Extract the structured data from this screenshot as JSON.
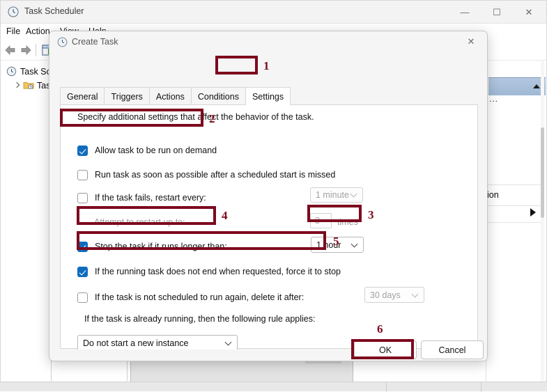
{
  "background_window": {
    "title": "Task Scheduler",
    "title_icon": "clock-icon",
    "controls": {
      "minimize": "—",
      "maximize": "☐",
      "close": "✕"
    },
    "menu": [
      "File",
      "Action",
      "View",
      "Help"
    ],
    "toolbar_icons": [
      "back-arrow-icon",
      "forward-arrow-icon",
      "grid-view-icon"
    ],
    "tree": {
      "root": "Task Sche",
      "child": "Task S"
    },
    "right_panel": {
      "ellipsis": "...",
      "partial_label": "ion"
    }
  },
  "dialog": {
    "title": "Create Task",
    "title_icon": "clock-icon",
    "close_glyph": "✕",
    "tabs": [
      {
        "label": "General",
        "active": false
      },
      {
        "label": "Triggers",
        "active": false
      },
      {
        "label": "Actions",
        "active": false
      },
      {
        "label": "Conditions",
        "active": false
      },
      {
        "label": "Settings",
        "active": true
      }
    ],
    "description": "Specify additional settings that affect the behavior of the task.",
    "options": [
      {
        "label": "Allow task to be run on demand",
        "checked": true,
        "disabled": false
      },
      {
        "label": "Run task as soon as possible after a scheduled start is missed",
        "checked": false,
        "disabled": false
      },
      {
        "label": "If the task fails, restart every:",
        "checked": false,
        "disabled": false
      },
      {
        "label": "Stop the task if it runs longer than:",
        "checked": true,
        "disabled": false
      },
      {
        "label": "If the running task does not end when requested, force it to stop",
        "checked": true,
        "disabled": false
      },
      {
        "label": "If the task is not scheduled to run again, delete it after:",
        "checked": false,
        "disabled": false
      }
    ],
    "attempt_label": "Attempt to restart up to:",
    "restart_interval_value": "1 minute",
    "restart_count_value": "3",
    "times_label": "times",
    "stop_after_value": "1 hour",
    "delete_after_value": "30 days",
    "rule_label": "If the task is already running, then the following rule applies:",
    "instance_rule_value": "Do not start a new instance",
    "buttons": {
      "ok": "OK",
      "cancel": "Cancel"
    }
  },
  "annotations": {
    "color": "#7d0a1e",
    "markers": [
      {
        "number": "1",
        "target": "settings-tab"
      },
      {
        "number": "2",
        "target": "allow-on-demand-checkbox"
      },
      {
        "number": "3",
        "target": "stop-after-duration-combo"
      },
      {
        "number": "4",
        "target": "stop-task-longer-than-checkbox"
      },
      {
        "number": "5",
        "target": "force-stop-checkbox"
      },
      {
        "number": "6",
        "target": "ok-button"
      }
    ]
  }
}
